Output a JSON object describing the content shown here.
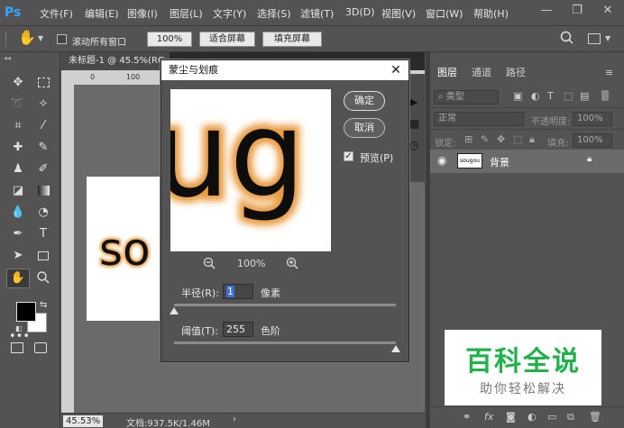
{
  "app": {
    "logo": "Ps"
  },
  "menu": [
    "文件(F)",
    "编辑(E)",
    "图像(I)",
    "图层(L)",
    "文字(Y)",
    "选择(S)",
    "滤镜(T)",
    "3D(D)",
    "视图(V)",
    "窗口(W)",
    "帮助(H)"
  ],
  "window_controls": {
    "minimize": "—",
    "restore": "❐",
    "close": "✕"
  },
  "options_bar": {
    "scroll_all_label": "滚动所有窗口",
    "zoom_100": "100%",
    "fit_screen": "适合屏幕",
    "fill_screen": "填充屏幕"
  },
  "document": {
    "tab_title": "未标题-1 @ 45.5%(RG",
    "ruler_marks": [
      "0",
      "100"
    ],
    "canvas_text": "so",
    "status_zoom": "45.53%",
    "status_doc": "文档:937.5K/1.46M"
  },
  "dialog": {
    "title": "蒙尘与划痕",
    "ok": "确定",
    "cancel": "取消",
    "preview_label": "预览(P)",
    "preview_checked": true,
    "preview_text": "ug",
    "zoom_pct": "100%",
    "radius_label": "半径(R):",
    "radius_value": "1",
    "radius_unit": "像素",
    "radius_level": 0.0,
    "threshold_label": "阈值(T):",
    "threshold_value": "255",
    "threshold_unit": "色阶",
    "threshold_level": 1.0
  },
  "layers_panel": {
    "tabs": [
      "图层",
      "通道",
      "路径"
    ],
    "filter_kind": "类型",
    "blend_mode": "正常",
    "opacity_label": "不透明度:",
    "opacity_value": "100%",
    "lock_label": "锁定:",
    "fill_label": "填充:",
    "fill_value": "100%",
    "layer_name": "背景",
    "layer_thumb_text": "sougou"
  },
  "watermark": {
    "title": "百科全说",
    "subtitle": "助你轻松解决"
  },
  "colors": {
    "accent": "#31a8ff",
    "glow": "#e89a3c",
    "watermark_green": "#22b24c"
  }
}
